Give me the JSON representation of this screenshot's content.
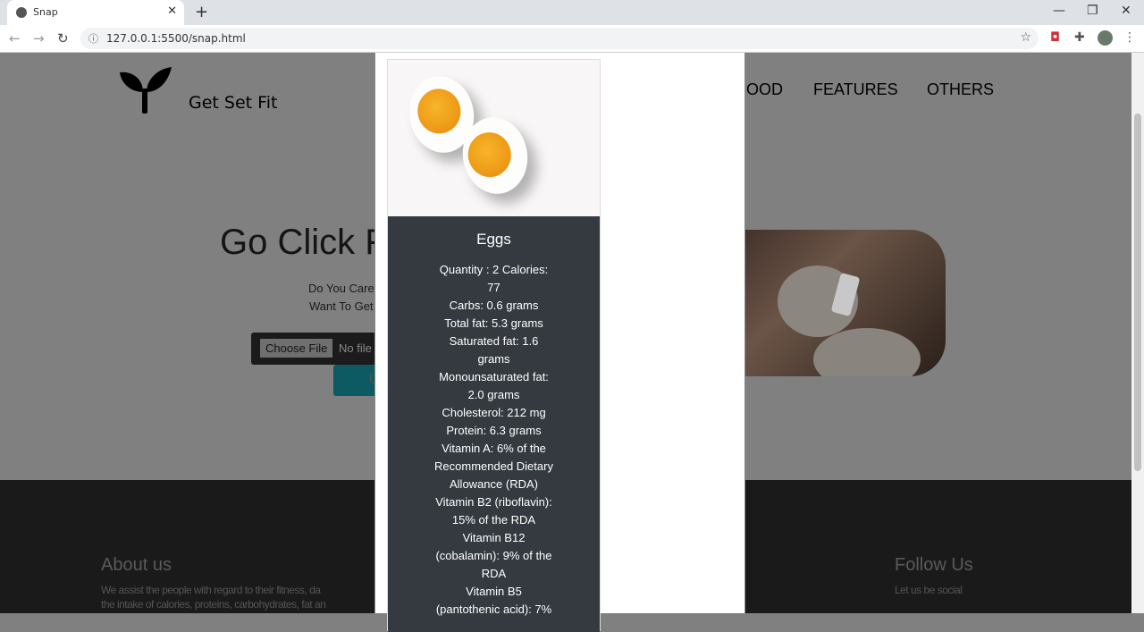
{
  "browser": {
    "tab_title": "Snap",
    "url": "127.0.0.1:5500/snap.html"
  },
  "header": {
    "brand": "Get Set Fit",
    "nav": [
      "OOD",
      "FEATURES",
      "OTHERS"
    ]
  },
  "hero": {
    "title": "Go Click F",
    "line1": "Do You Care",
    "line2": "Want To Get",
    "choose_file": "Choose File",
    "no_file": "No file",
    "upload_label": "U"
  },
  "footer": {
    "about_title": "About us",
    "about_line1": "We assist the people with regard to their fitness, da",
    "about_line2": "the intake of calories, proteins, carbohydrates, fat an",
    "follow_title": "Follow Us",
    "follow_text": "Let us be social"
  },
  "card": {
    "title": "Eggs",
    "lines": [
      "Quantity : 2 Calories:",
      "77",
      "Carbs: 0.6 grams",
      "Total fat: 5.3 grams",
      "Saturated fat: 1.6",
      "grams",
      "Monounsaturated fat:",
      "2.0 grams",
      "Cholesterol: 212 mg",
      "Protein: 6.3 grams",
      "Vitamin A: 6% of the",
      "Recommended Dietary",
      "Allowance (RDA)",
      "Vitamin B2 (riboflavin):",
      "15% of the RDA",
      "Vitamin B12",
      "(cobalamin): 9% of the",
      "RDA",
      "Vitamin B5",
      "(pantothenic acid): 7%"
    ]
  }
}
